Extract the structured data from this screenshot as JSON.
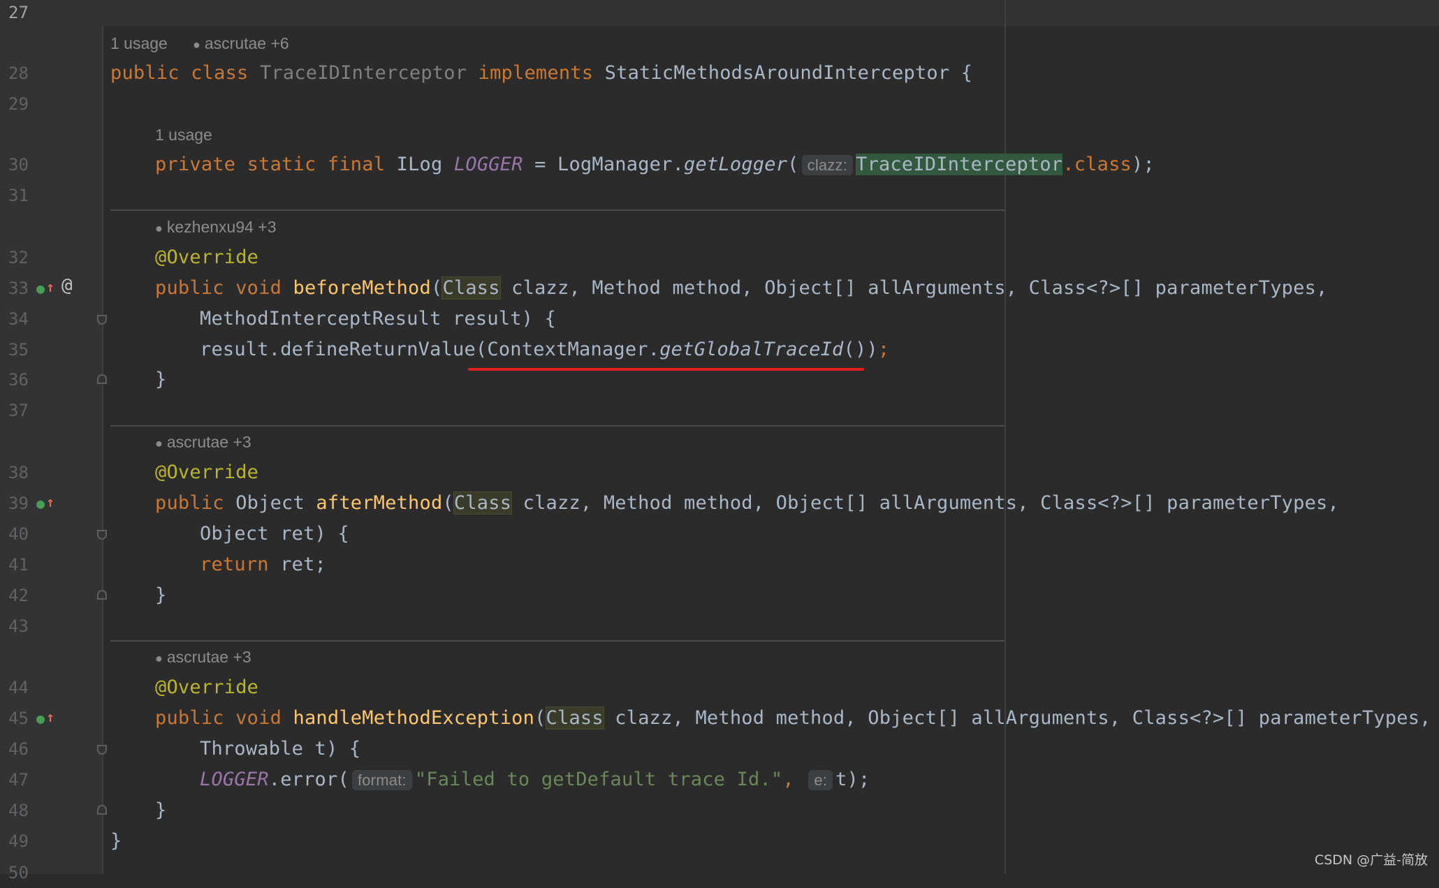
{
  "editor": {
    "line_numbers": [
      "27",
      "28",
      "29",
      "30",
      "31",
      "32",
      "33",
      "34",
      "35",
      "36",
      "37",
      "38",
      "39",
      "40",
      "41",
      "42",
      "43",
      "44",
      "45",
      "46",
      "47",
      "48",
      "49",
      "50"
    ],
    "current_line": "27",
    "inlays": {
      "class_usage": "1 usage",
      "class_author": "ascrutae +6",
      "logger_usage": "1 usage",
      "before_author": "kezhenxu94 +3",
      "after_author": "ascrutae +3",
      "handle_author": "ascrutae +3"
    },
    "hints": {
      "clazz": "clazz:",
      "format": "format:",
      "e": "e:"
    },
    "tokens": {
      "public": "public",
      "class_kw": "class",
      "class_name": "TraceIDInterceptor",
      "implements": "implements",
      "interface_name": "StaticMethodsAroundInterceptor",
      "open_brace": " {",
      "private": "private",
      "static": "static",
      "final": "final",
      "ilog": "ILog",
      "logger": "LOGGER",
      "equals": " = LogManager.",
      "get_logger": "getLogger",
      "paren_open": "(",
      "dot_class": ".class",
      "close_semi": ");",
      "override": "@Override",
      "void": "void",
      "before_method": "beforeMethod",
      "class_param": "Class",
      "params_tail": " clazz, Method method, Object[] allArguments, Class<?>[] parameterTypes,",
      "before_line2": "MethodInterceptResult result) {",
      "define_prefix": "result.defineReturnValue(ContextManager.",
      "get_global": "getGlobalTraceId",
      "define_suffix": "())",
      "semi": ";",
      "close_brace": "}",
      "object": "Object",
      "after_method": "afterMethod",
      "after_line2": "Object ret) {",
      "return_kw": "return",
      "return_tail": " ret;",
      "handle_method": "handleMethodException",
      "handle_line2": "Throwable t) {",
      "error_call": ".error(",
      "error_msg": "\"Failed to getDefault trace Id.\"",
      "comma": ", ",
      "t_close": "t);"
    }
  },
  "watermark": "CSDN @广益-简放"
}
